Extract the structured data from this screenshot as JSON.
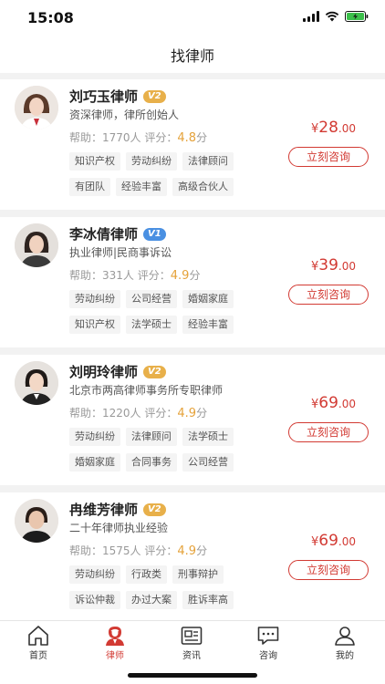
{
  "status_bar": {
    "time": "15:08"
  },
  "header": {
    "title": "找律师"
  },
  "lawyers": [
    {
      "name": "刘巧玉律师",
      "level": "V2",
      "title": "资深律师，律所创始人",
      "help_label": "帮助：",
      "help_count": "1770人",
      "score_label": "评分：",
      "score": "4.8",
      "score_unit": "分",
      "tags": [
        [
          "知识产权",
          "劳动纠纷",
          "法律顾问"
        ],
        [
          "有团队",
          "经验丰富",
          "高级合伙人"
        ]
      ],
      "price_currency": "¥",
      "price_int": "28",
      "price_dec": ".00",
      "consult_label": "立刻咨询"
    },
    {
      "name": "李冰倩律师",
      "level": "V1",
      "title": "执业律师|民商事诉讼",
      "help_label": "帮助：",
      "help_count": "331人",
      "score_label": "评分：",
      "score": "4.9",
      "score_unit": "分",
      "tags": [
        [
          "劳动纠纷",
          "公司经营",
          "婚姻家庭"
        ],
        [
          "知识产权",
          "法学硕士",
          "经验丰富"
        ]
      ],
      "price_currency": "¥",
      "price_int": "39",
      "price_dec": ".00",
      "consult_label": "立刻咨询"
    },
    {
      "name": "刘明玲律师",
      "level": "V2",
      "title": "北京市两高律师事务所专职律师",
      "help_label": "帮助：",
      "help_count": "1220人",
      "score_label": "评分：",
      "score": "4.9",
      "score_unit": "分",
      "tags": [
        [
          "劳动纠纷",
          "法律顾问",
          "法学硕士"
        ],
        [
          "婚姻家庭",
          "合同事务",
          "公司经营"
        ]
      ],
      "price_currency": "¥",
      "price_int": "69",
      "price_dec": ".00",
      "consult_label": "立刻咨询"
    },
    {
      "name": "冉维芳律师",
      "level": "V2",
      "title": "二十年律师执业经验",
      "help_label": "帮助：",
      "help_count": "1575人",
      "score_label": "评分：",
      "score": "4.9",
      "score_unit": "分",
      "tags": [
        [
          "劳动纠纷",
          "行政类",
          "刑事辩护"
        ],
        [
          "诉讼仲裁",
          "办过大案",
          "胜诉率高"
        ]
      ],
      "price_currency": "¥",
      "price_int": "69",
      "price_dec": ".00",
      "consult_label": "立刻咨询"
    }
  ],
  "tabbar": {
    "items": [
      {
        "label": "首页",
        "icon": "home-icon"
      },
      {
        "label": "律师",
        "icon": "lawyer-icon",
        "active": true
      },
      {
        "label": "资讯",
        "icon": "news-icon"
      },
      {
        "label": "咨询",
        "icon": "chat-icon"
      },
      {
        "label": "我的",
        "icon": "profile-icon"
      }
    ]
  },
  "colors": {
    "accent": "#d23a33",
    "score": "#e5a23a",
    "badge_gold": "#e8b04a",
    "badge_blue": "#4a90e2"
  }
}
